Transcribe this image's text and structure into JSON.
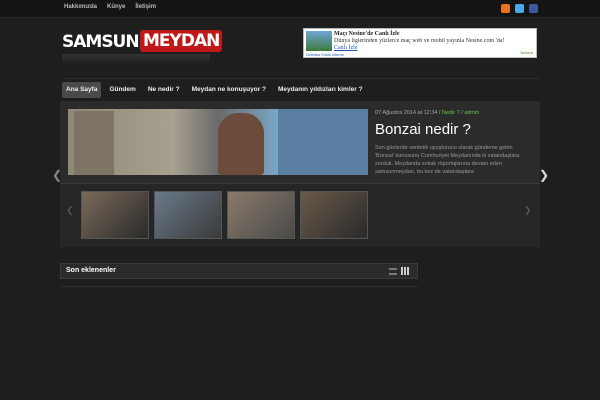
{
  "topnav": [
    "Hakkımızda",
    "Künye",
    "İletişim"
  ],
  "social": {
    "rss_icon": "rss-icon",
    "twitter_icon": "twitter-icon",
    "facebook_icon": "facebook-icon"
  },
  "logo": {
    "part1": "SAMSUN",
    "part2": "MEYDAN"
  },
  "ad": {
    "title": "Maçı Nesine'de Canlı İzle",
    "line": "Dünya liglerinden yüzlerce maç web ve mobil yayınla Nesine.com 'da!",
    "link": "Canlı İzle",
    "small": "Ücretsiz Canlı İzleme",
    "brand": "Nesine"
  },
  "nav": [
    "Ana Sayfa",
    "Gündem",
    "Ne nedir ?",
    "Meydan ne konuşuyor ?",
    "Meydanın yıldızları kimler ?"
  ],
  "slide": {
    "date": "07 Ağustos 2014 at 12:34",
    "sep": " / ",
    "category": "Nedir ?",
    "author": "admin",
    "title": "Bonzai nedir ?",
    "excerpt": "Son günlerde sentetik uyuşturucu olarak gündeme gelen 'Bonzai' konusunu Cumhuriyet Meydanında ki vatandaşlara sorduk. Meydanda sokak röportajlarına devam eden samsunmeydan, bu kez de vatandaşlara"
  },
  "section": {
    "label": "Son eklenenler"
  }
}
